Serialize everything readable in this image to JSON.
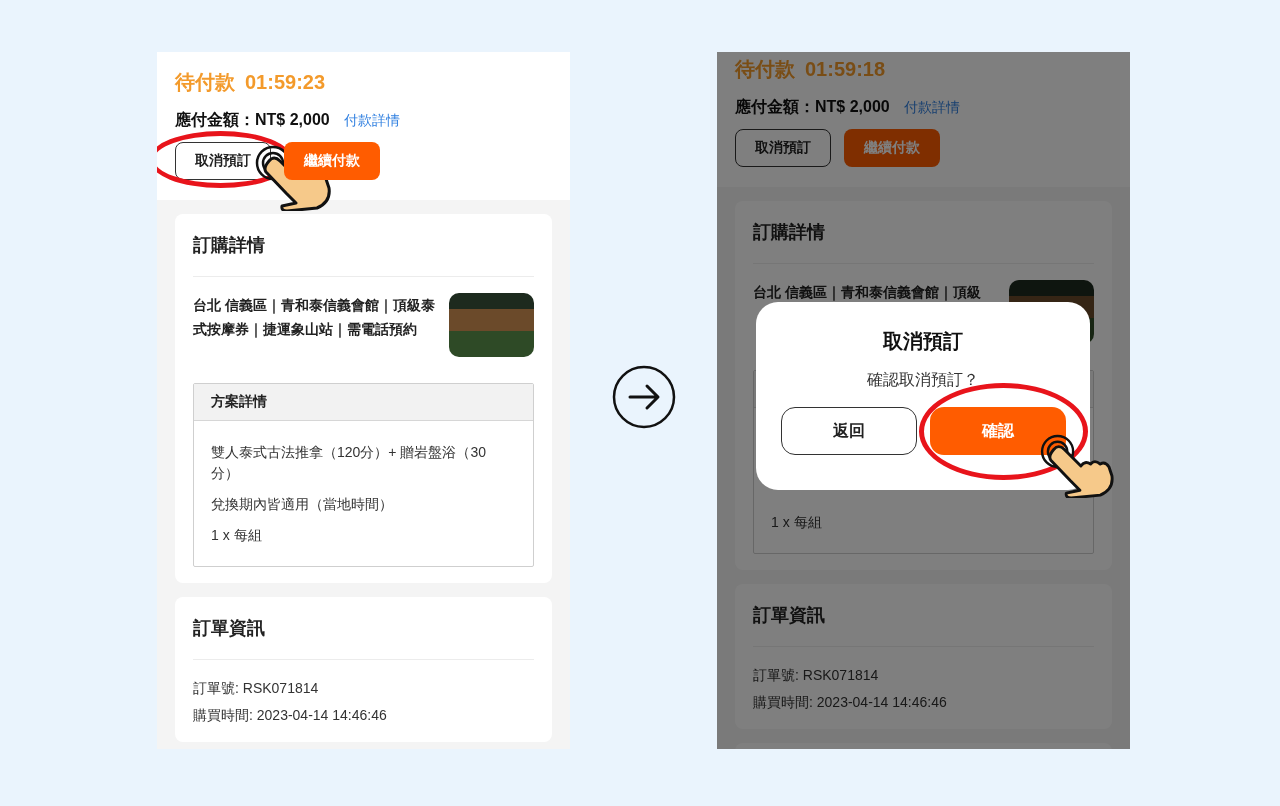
{
  "screens": [
    {
      "header": {
        "status": "待付款",
        "countdown": "01:59:23",
        "amount": "應付金額：NT$ 2,000",
        "payment_link": "付款詳情",
        "buttons": [
          {
            "label": "取消預訂",
            "kind": "outline",
            "highlighted": true
          },
          {
            "label": "繼續付款",
            "kind": "primary",
            "highlighted": false
          }
        ]
      },
      "order_details": {
        "title": "訂購詳情",
        "product_title": "台北 信義區｜青和泰信義會館｜頂級泰式按摩券｜捷運象山站｜需電話預約",
        "plan": {
          "title": "方案詳情",
          "lines": [
            "雙人泰式古法推拿（120分）+ 贈岩盤浴（30分）",
            "兌換期內皆適用（當地時間）",
            "1 x 每組"
          ]
        }
      },
      "order_info": {
        "title": "訂單資訊",
        "lines": [
          "訂單號: RSK071814",
          "購買時間: 2023-04-14 14:46:46"
        ]
      }
    },
    {
      "header": {
        "status": "待付款",
        "countdown": "01:59:18",
        "amount": "應付金額：NT$ 2,000",
        "payment_link": "付款詳情",
        "buttons": [
          {
            "label": "取消預訂",
            "kind": "outline",
            "highlighted": false
          },
          {
            "label": "繼續付款",
            "kind": "primary",
            "highlighted": false
          }
        ]
      },
      "order_details": {
        "title": "訂購詳情",
        "product_title": "台北 信義區｜青和泰信義會館｜頂級",
        "plan": {
          "lines": [
            "1 x 每組"
          ]
        }
      },
      "order_info": {
        "title": "訂單資訊",
        "lines": [
          "訂單號: RSK071814",
          "購買時間: 2023-04-14 14:46:46"
        ]
      },
      "dialog": {
        "title": "取消預訂",
        "message": "確認取消預訂？",
        "buttons": [
          {
            "label": "返回",
            "kind": "outline",
            "highlighted": false
          },
          {
            "label": "確認",
            "kind": "primary",
            "highlighted": true
          }
        ]
      }
    }
  ]
}
